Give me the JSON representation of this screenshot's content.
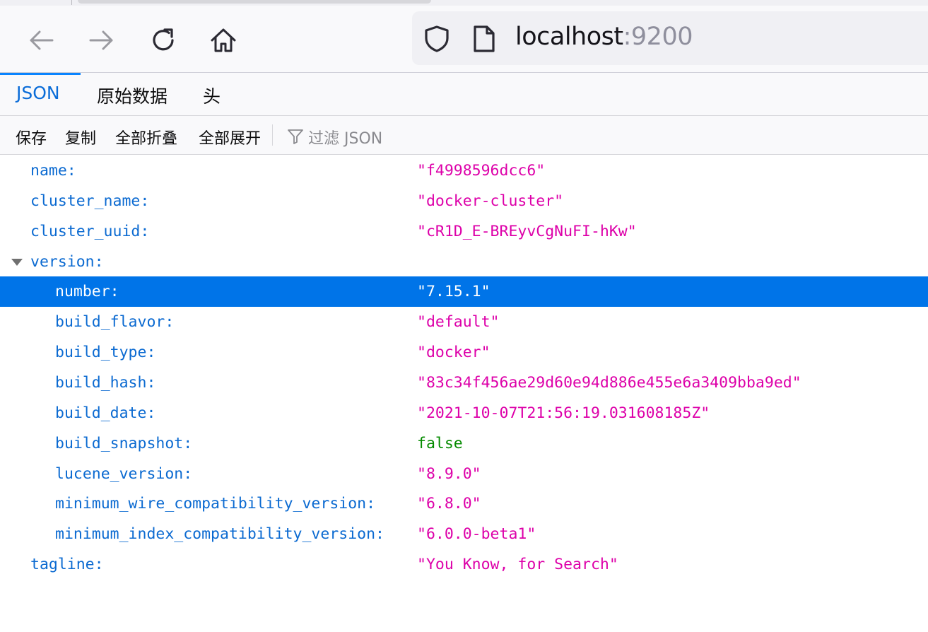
{
  "browser": {
    "url_host": "localhost",
    "url_port": ":9200",
    "icons": [
      "back-icon",
      "forward-icon",
      "reload-icon",
      "home-icon",
      "shield-icon",
      "page-icon"
    ]
  },
  "viewer_tabs": [
    {
      "label": "JSON",
      "active": true
    },
    {
      "label": "原始数据",
      "active": false
    },
    {
      "label": "头",
      "active": false
    }
  ],
  "toolbar": {
    "save": "保存",
    "copy": "复制",
    "collapse_all": "全部折叠",
    "expand_all": "全部展开",
    "filter_placeholder": "过滤 JSON"
  },
  "json_rows": [
    {
      "key": "name:",
      "value": "\"f4998596dcc6\"",
      "type": "string",
      "level": 0
    },
    {
      "key": "cluster_name:",
      "value": "\"docker-cluster\"",
      "type": "string",
      "level": 0
    },
    {
      "key": "cluster_uuid:",
      "value": "\"cR1D_E-BREyvCgNuFI-hKw\"",
      "type": "string",
      "level": 0
    },
    {
      "key": "version:",
      "value": "",
      "type": "object",
      "level": 0,
      "expanded": true
    },
    {
      "key": "number:",
      "value": "\"7.15.1\"",
      "type": "string",
      "level": 1,
      "selected": true
    },
    {
      "key": "build_flavor:",
      "value": "\"default\"",
      "type": "string",
      "level": 1
    },
    {
      "key": "build_type:",
      "value": "\"docker\"",
      "type": "string",
      "level": 1
    },
    {
      "key": "build_hash:",
      "value": "\"83c34f456ae29d60e94d886e455e6a3409bba9ed\"",
      "type": "string",
      "level": 1
    },
    {
      "key": "build_date:",
      "value": "\"2021-10-07T21:56:19.031608185Z\"",
      "type": "string",
      "level": 1
    },
    {
      "key": "build_snapshot:",
      "value": "false",
      "type": "boolean",
      "level": 1
    },
    {
      "key": "lucene_version:",
      "value": "\"8.9.0\"",
      "type": "string",
      "level": 1
    },
    {
      "key": "minimum_wire_compatibility_version:",
      "value": "\"6.8.0\"",
      "type": "string",
      "level": 1
    },
    {
      "key": "minimum_index_compatibility_version:",
      "value": "\"6.0.0-beta1\"",
      "type": "string",
      "level": 1
    },
    {
      "key": "tagline:",
      "value": "\"You Know, for Search\"",
      "type": "string",
      "level": 0
    }
  ],
  "colors": {
    "key": "#0b6ad1",
    "string": "#dd00a9",
    "boolean": "#058b00",
    "selected_row": "#0074e8",
    "active_tab": "#0a6cd8"
  }
}
